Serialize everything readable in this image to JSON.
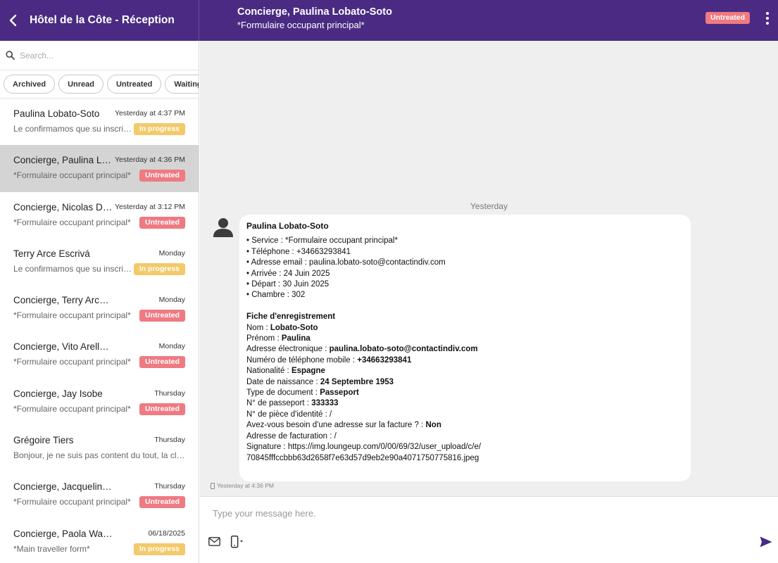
{
  "colors": {
    "brand": "#4a2a82",
    "untreated": "#ef7a82",
    "in_progress": "#f3c96a"
  },
  "header": {
    "app_title": "Hôtel de la Côte - Réception",
    "conversation_title": "Concierge, Paulina Lobato-Soto",
    "conversation_subtitle": "*Formulaire occupant principal*",
    "status_badge": "Untreated",
    "icons": [
      "back-arrow-icon",
      "more-vertical-icon"
    ]
  },
  "sidebar": {
    "search_placeholder": "Search...",
    "filters": [
      "Archived",
      "Unread",
      "Untreated",
      "Waiting"
    ],
    "conversations": [
      {
        "name": "Paulina Lobato-Soto",
        "time": "Yesterday at 4:37 PM",
        "preview": "Le confirmamos que su inscripción ha sido recibida",
        "badge": "In progress",
        "badge_type": "progress"
      },
      {
        "name": "Concierge, Paulina Lobato-Soto",
        "time": "Yesterday at 4:36 PM",
        "preview": "*Formulaire occupant principal*",
        "badge": "Untreated",
        "badge_type": "untreated",
        "selected": true
      },
      {
        "name": "Concierge, Nicolas Durand",
        "time": "Yesterday at 3:12 PM",
        "preview": "*Formulaire occupant principal*",
        "badge": "Untreated",
        "badge_type": "untreated"
      },
      {
        "name": "Terry Arce Escrivá",
        "time": "Monday",
        "preview": "Le confirmamos que su inscripción ha sido recibida",
        "badge": "In progress",
        "badge_type": "progress"
      },
      {
        "name": "Concierge, Terry Arce Escrivá",
        "time": "Monday",
        "preview": "*Formulaire occupant principal*",
        "badge": "Untreated",
        "badge_type": "untreated"
      },
      {
        "name": "Concierge, Vito Arellano Rosell",
        "time": "Monday",
        "preview": "*Formulaire occupant principal*",
        "badge": "Untreated",
        "badge_type": "untreated"
      },
      {
        "name": "Concierge, Jay Isobe",
        "time": "Thursday",
        "preview": "*Formulaire occupant principal*",
        "badge": "Untreated",
        "badge_type": "untreated"
      },
      {
        "name": "Grégoire Tiers",
        "time": "Thursday",
        "preview": "Bonjour, je ne suis pas content du tout, la climatisation",
        "badge": "",
        "badge_type": ""
      },
      {
        "name": "Concierge, Jacqueline Estrada",
        "time": "Thursday",
        "preview": "*Formulaire occupant principal*",
        "badge": "Untreated",
        "badge_type": "untreated"
      },
      {
        "name": "Concierge, Paola Wagner",
        "time": "06/18/2025",
        "preview": "*Main traveller form*",
        "badge": "In progress",
        "badge_type": "progress"
      }
    ]
  },
  "chat": {
    "day_separator": "Yesterday",
    "message": {
      "sender": "Paulina Lobato-Soto",
      "bullets": [
        "• Service : *Formulaire occupant principal*",
        "• Téléphone : +34663293841",
        "• Adresse email : paulina.lobato-soto@contactindiv.com",
        "• Arrivée : 24 Juin 2025",
        "• Départ : 30 Juin 2025",
        "• Chambre : 302"
      ],
      "form_title": "Fiche d'enregistrement",
      "fields": [
        {
          "label": "Nom : ",
          "value": "Lobato-Soto"
        },
        {
          "label": "Prénom : ",
          "value": "Paulina"
        },
        {
          "label": "Adresse électronique : ",
          "value": "paulina.lobato-soto@contactindiv.com"
        },
        {
          "label": "Numéro de téléphone mobile : ",
          "value": "+34663293841"
        },
        {
          "label": "Nationalité : ",
          "value": "Espagne"
        },
        {
          "label": "Date de naissance : ",
          "value": "24 Septembre 1953"
        },
        {
          "label": "Type de document : ",
          "value": "Passeport"
        },
        {
          "label": "N° de passeport : ",
          "value": "333333"
        },
        {
          "label": "N° de pièce d'identité : /",
          "value": ""
        },
        {
          "label": "Avez-vous besoin d'une adresse sur la facture ? : ",
          "value": "Non"
        },
        {
          "label": "Adresse de facturation : /",
          "value": ""
        },
        {
          "label": "Signature : https://img.loungeup.com/0/00/69/32/user_upload/c/e/",
          "value": ""
        },
        {
          "label": "70845fffccbbb63d2658f7e63d57d9eb2e90a4071750775816.jpeg",
          "value": ""
        }
      ],
      "timestamp": "Yesterday at 4:36 PM"
    }
  },
  "composer": {
    "placeholder": "Type your message here.",
    "icons": [
      "mail-icon",
      "phone-icon",
      "send-icon"
    ]
  }
}
